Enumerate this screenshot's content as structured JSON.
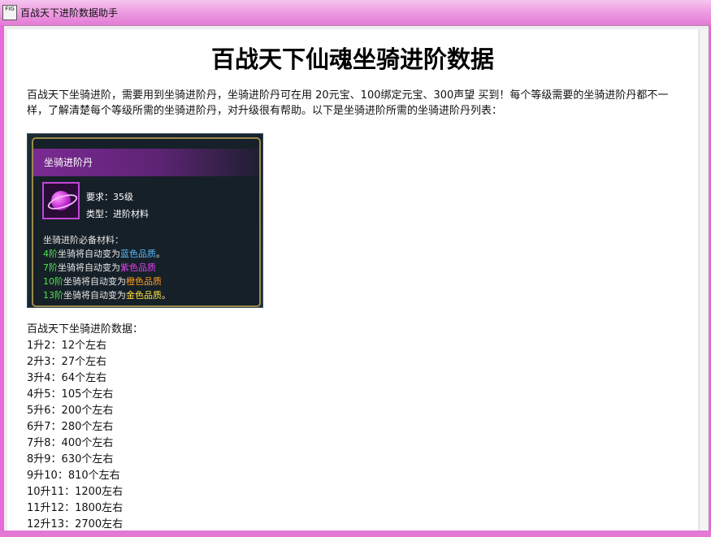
{
  "window": {
    "title": "百战天下进阶数据助手",
    "icon_text": "FIG"
  },
  "page": {
    "heading": "百战天下仙魂坐骑进阶数据",
    "intro": "百战天下坐骑进阶，需要用到坐骑进阶丹，坐骑进阶丹可在用 20元宝、100绑定元宝、300声望 买到！每个等级需要的坐骑进阶丹都不一样，了解清楚每个等级所需的坐骑进阶丹，对升级很有帮助。以下是坐骑进阶所需的坐骑进阶丹列表："
  },
  "item_card": {
    "name": "坐骑进阶丹",
    "requirement": "要求：35级",
    "type": "类型：进阶材料",
    "materials_title": "坐骑进阶必备材料：",
    "materials": [
      {
        "level": "4阶",
        "text": "坐骑将自动变为",
        "quality": "蓝色品质",
        "end": "。"
      },
      {
        "level": "7阶",
        "text": "坐骑将自动变为",
        "quality": "紫色品质",
        "end": ""
      },
      {
        "level": "10阶",
        "text": "坐骑将自动变为",
        "quality": "橙色品质",
        "end": ""
      },
      {
        "level": "13阶",
        "text": "坐骑将自动变为",
        "quality": "金色品质",
        "end": "。"
      }
    ]
  },
  "upgrade_data": {
    "title": "百战天下坐骑进阶数据：",
    "rows": [
      "1升2：12个左右",
      "2升3：27个左右",
      "3升4：64个左右",
      "4升5：105个左右",
      "5升6：200个左右",
      "6升7：280个左右",
      "7升8：400个左右",
      "8升9：630个左右",
      "9升10：810个左右",
      "10升11：1200左右",
      "11升12：1800左右",
      "12升13：2700左右"
    ]
  },
  "colors": {
    "titlebar": "#ee9fe2",
    "quality_blue": "#59b9ff",
    "quality_purple": "#e23eef",
    "quality_orange": "#ff9e24",
    "quality_gold": "#ffe23c",
    "level_green": "#50e44e"
  },
  "icons": {
    "app": "app-icon",
    "item": "purple-orb-icon"
  }
}
